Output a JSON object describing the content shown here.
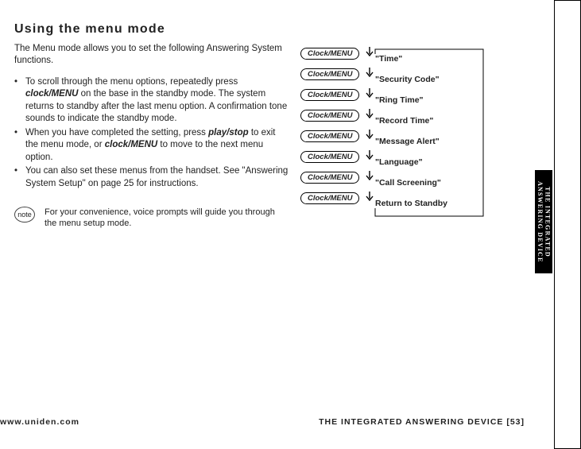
{
  "heading": "Using the menu mode",
  "intro": "The Menu mode allows you to set the following Answering System functions.",
  "bullets": [
    {
      "pre": "To scroll through the menu options, repeatedly press ",
      "em": "clock/MENU",
      "post": " on the base in the standby mode. The system returns to standby after the last menu option. A confirmation tone sounds to indicate the standby mode."
    },
    {
      "pre": "When you have completed the setting, press ",
      "em": "play/stop",
      "post": " to exit the menu mode, or ",
      "em2": "clock/MENU",
      "post2": " to move to the next menu option."
    },
    {
      "pre": "You can also set these menus from the handset. See \"Answering System Setup\" on page 25 for instructions.",
      "em": "",
      "post": ""
    }
  ],
  "note_icon": "note",
  "note_text": "For your convenience, voice prompts will guide you through the menu setup mode.",
  "menu_button": "Clock/MENU",
  "menu_items": [
    "\"Time\"",
    "\"Security Code\"",
    "\"Ring Time\"",
    "\"Record Time\"",
    "\"Message Alert\"",
    "\"Language\"",
    "\"Call Screening\"",
    "Return to Standby"
  ],
  "sidebar": "THE INTEGRATED\nANSWERING DEVICE",
  "footer_left": "www.uniden.com",
  "footer_right": "THE INTEGRATED ANSWERING DEVICE [53]"
}
